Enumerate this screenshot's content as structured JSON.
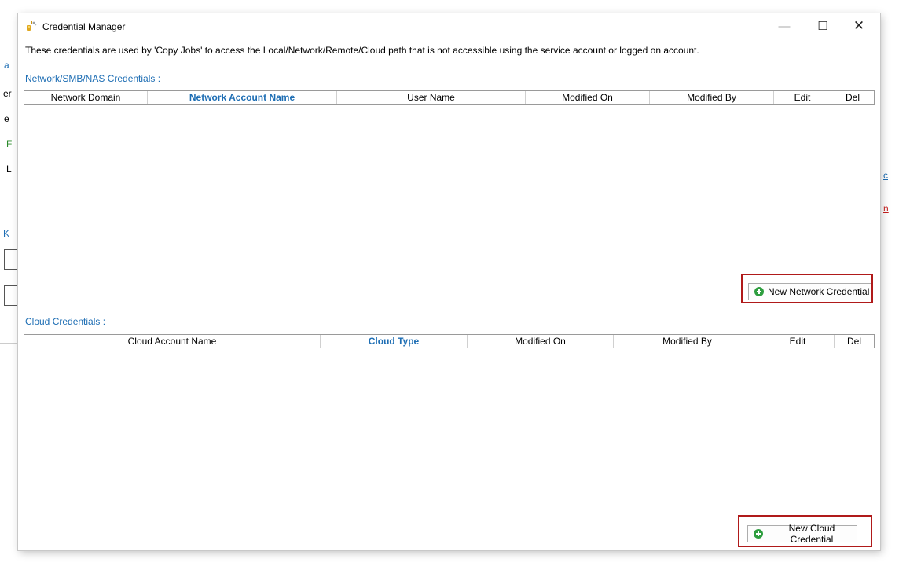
{
  "background": {
    "fragments": [
      {
        "text": "a",
        "color": "#1e6eb4"
      },
      {
        "text": "er",
        "color": "#000000"
      },
      {
        "text": "e",
        "color": "#000000"
      },
      {
        "text": "F",
        "color": "#2a8a2a"
      },
      {
        "text": "L",
        "color": "#000000"
      },
      {
        "text": "K",
        "color": "#1e6eb4"
      },
      {
        "text": "c",
        "color": "#1e6eb4"
      },
      {
        "text": "n",
        "color": "#c81e1e"
      }
    ]
  },
  "window": {
    "title": "Credential Manager",
    "minimize_glyph": "—",
    "maximize_glyph": "☐",
    "close_glyph": "✕"
  },
  "info_text": "These credentials are used by 'Copy Jobs' to access the Local/Network/Remote/Cloud path that is not accessible using the service account or logged on account.",
  "network": {
    "label": "Network/SMB/NAS Credentials :",
    "columns": [
      "Network Domain",
      "Network Account Name",
      "User Name",
      "Modified On",
      "Modified By",
      "Edit",
      "Del"
    ],
    "sorted_column": "Network Account Name",
    "rows": [],
    "new_button": "New Network Credential"
  },
  "cloud": {
    "label": "Cloud Credentials :",
    "columns": [
      "Cloud Account Name",
      "Cloud Type",
      "Modified On",
      "Modified By",
      "Edit",
      "Del"
    ],
    "sorted_column": "Cloud Type",
    "rows": [],
    "new_button": "New Cloud Credential"
  },
  "colors": {
    "accent": "#1e6eb4",
    "highlight": "#b01a1a",
    "add_icon": "#2e9e3f"
  }
}
